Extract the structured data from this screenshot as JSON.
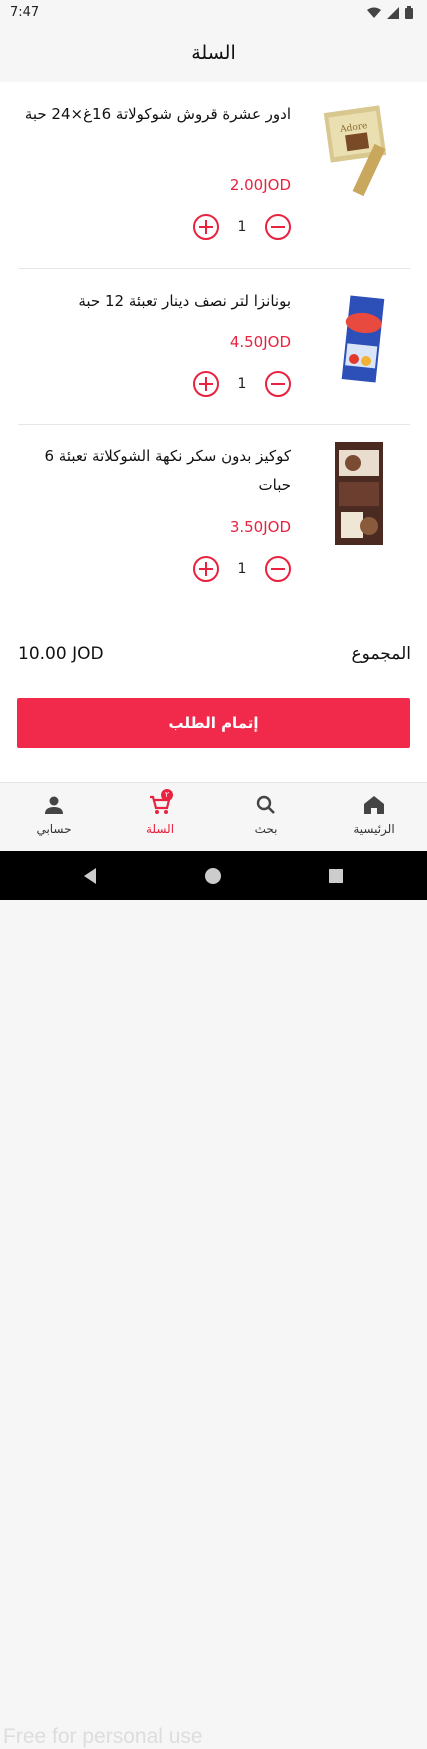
{
  "status": {
    "time": "7:47"
  },
  "appbar": {
    "title": "السلة"
  },
  "items": [
    {
      "name": "ادور عشرة قروش شوكولاتة 16غ×24 حبة",
      "price": "2.00JOD",
      "qty": "1"
    },
    {
      "name": "بونانزا لتر نصف دينار تعبئة 12 حبة",
      "price": "4.50JOD",
      "qty": "1"
    },
    {
      "name": "كوكيز بدون سكر نكهة الشوكلاتة تعبئة 6 حبات",
      "price": "3.50JOD",
      "qty": "1"
    }
  ],
  "summary": {
    "total_label": "المجموع",
    "total_value": "10.00 JOD"
  },
  "checkout": {
    "label": "إتمام الطلب"
  },
  "nav": {
    "home": "الرئيسية",
    "search": "بحث",
    "cart": "السلة",
    "cart_badge": "٢",
    "account": "حسابي"
  },
  "watermark": "Free for personal use",
  "colors": {
    "accent": "#f1294b",
    "price": "#e8223f"
  }
}
